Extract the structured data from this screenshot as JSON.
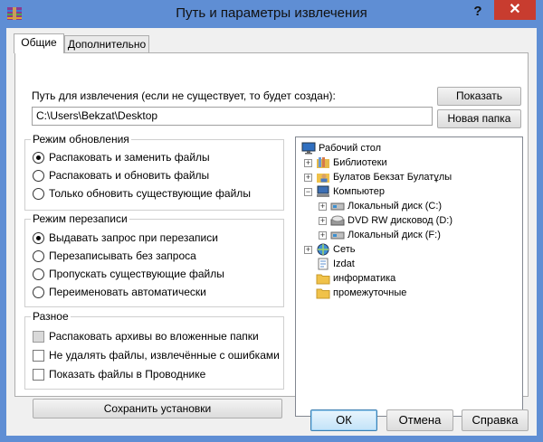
{
  "window": {
    "title": "Путь и параметры извлечения",
    "help_label": "?",
    "close_label": "✕"
  },
  "tabs": [
    {
      "label": "Общие",
      "active": true
    },
    {
      "label": "Дополнительно",
      "active": false
    }
  ],
  "path": {
    "label": "Путь для извлечения (если не существует, то будет создан):",
    "value": "C:\\Users\\Bekzat\\Desktop",
    "show_button": "Показать",
    "new_folder_button": "Новая папка"
  },
  "update_mode": {
    "title": "Режим обновления",
    "options": [
      {
        "label": "Распаковать и заменить файлы",
        "selected": true
      },
      {
        "label": "Распаковать и обновить файлы",
        "selected": false
      },
      {
        "label": "Только обновить существующие файлы",
        "selected": false
      }
    ]
  },
  "overwrite_mode": {
    "title": "Режим перезаписи",
    "options": [
      {
        "label": "Выдавать запрос при перезаписи",
        "selected": true
      },
      {
        "label": "Перезаписывать без запроса",
        "selected": false
      },
      {
        "label": "Пропускать существующие файлы",
        "selected": false
      },
      {
        "label": "Переименовать автоматически",
        "selected": false
      }
    ]
  },
  "misc": {
    "title": "Разное",
    "options": [
      {
        "label": "Распаковать архивы во вложенные папки",
        "checked": false,
        "enabled": false
      },
      {
        "label": "Не удалять файлы, извлечённые с ошибками",
        "checked": false,
        "enabled": true
      },
      {
        "label": "Показать файлы в Проводнике",
        "checked": false,
        "enabled": true
      }
    ]
  },
  "save_button": "Сохранить установки",
  "tree": [
    {
      "label": "Рабочий стол",
      "icon": "desktop-icon",
      "expander": ""
    },
    {
      "label": "Библиотеки",
      "icon": "libraries-icon",
      "expander": "+"
    },
    {
      "label": "Булатов Бекзат Булатұлы",
      "icon": "user-folder-icon",
      "expander": "+"
    },
    {
      "label": "Компьютер",
      "icon": "computer-icon",
      "expander": "−"
    },
    {
      "label": "Локальный диск (C:)",
      "icon": "drive-icon",
      "expander": "+"
    },
    {
      "label": "DVD RW дисковод (D:)",
      "icon": "dvd-drive-icon",
      "expander": "+"
    },
    {
      "label": "Локальный диск (F:)",
      "icon": "drive-icon",
      "expander": "+"
    },
    {
      "label": "Сеть",
      "icon": "network-icon",
      "expander": "+"
    },
    {
      "label": "Izdat",
      "icon": "document-icon",
      "expander": ""
    },
    {
      "label": "информатика",
      "icon": "folder-icon",
      "expander": ""
    },
    {
      "label": "промежуточные",
      "icon": "folder-icon",
      "expander": ""
    }
  ],
  "footer": {
    "ok": "ОК",
    "cancel": "Отмена",
    "help": "Справка"
  },
  "colors": {
    "titlebar": "#5f8ed4",
    "close": "#c83c2f",
    "folder": "#f0c24a"
  }
}
